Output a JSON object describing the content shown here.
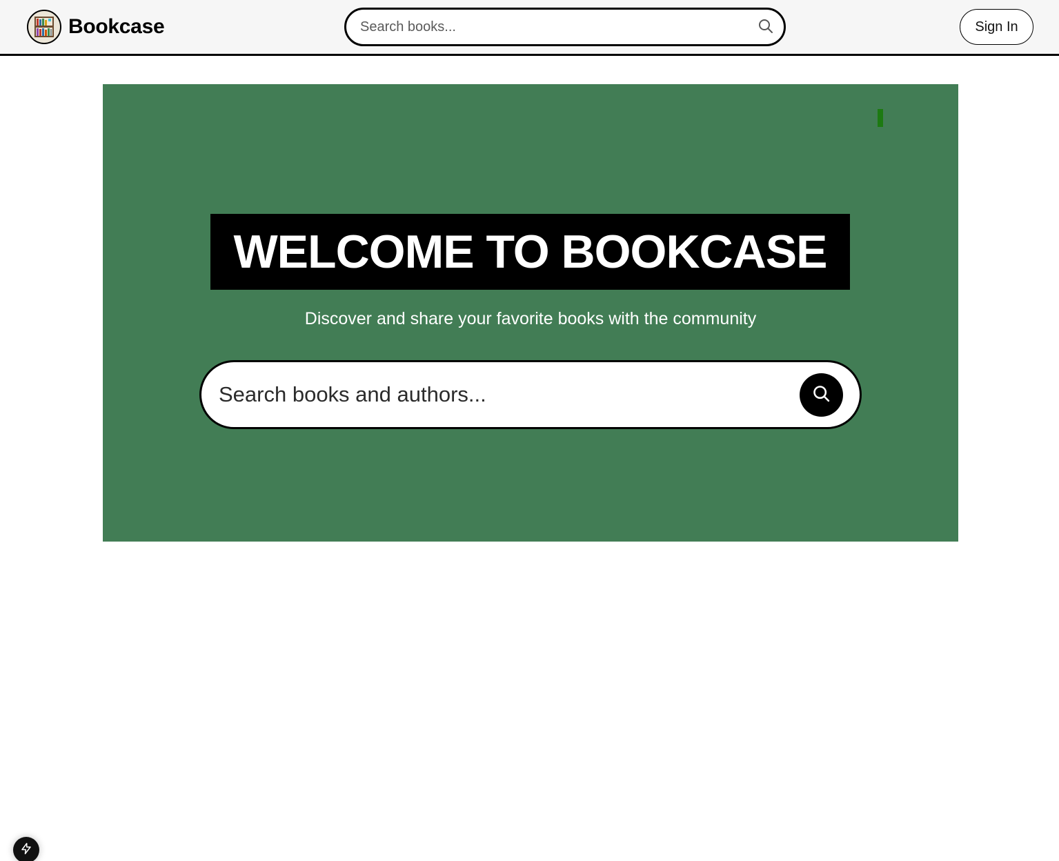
{
  "header": {
    "logo_icon": "bookshelf-logo-icon",
    "brand_name": "Bookcase",
    "search": {
      "placeholder": "Search books...",
      "icon": "search-icon"
    },
    "signin_label": "Sign In"
  },
  "hero": {
    "title": "WELCOME TO BOOKCASE",
    "subtitle": "Discover and share your favorite books with the community",
    "search": {
      "placeholder": "Search books and authors...",
      "icon": "search-icon"
    }
  },
  "dev_badge": {
    "icon": "lightning-icon"
  },
  "colors": {
    "hero_background": "#427d55",
    "header_background": "#f6f6f6",
    "title_background": "#000000",
    "accent_mark": "#1d7a12"
  }
}
